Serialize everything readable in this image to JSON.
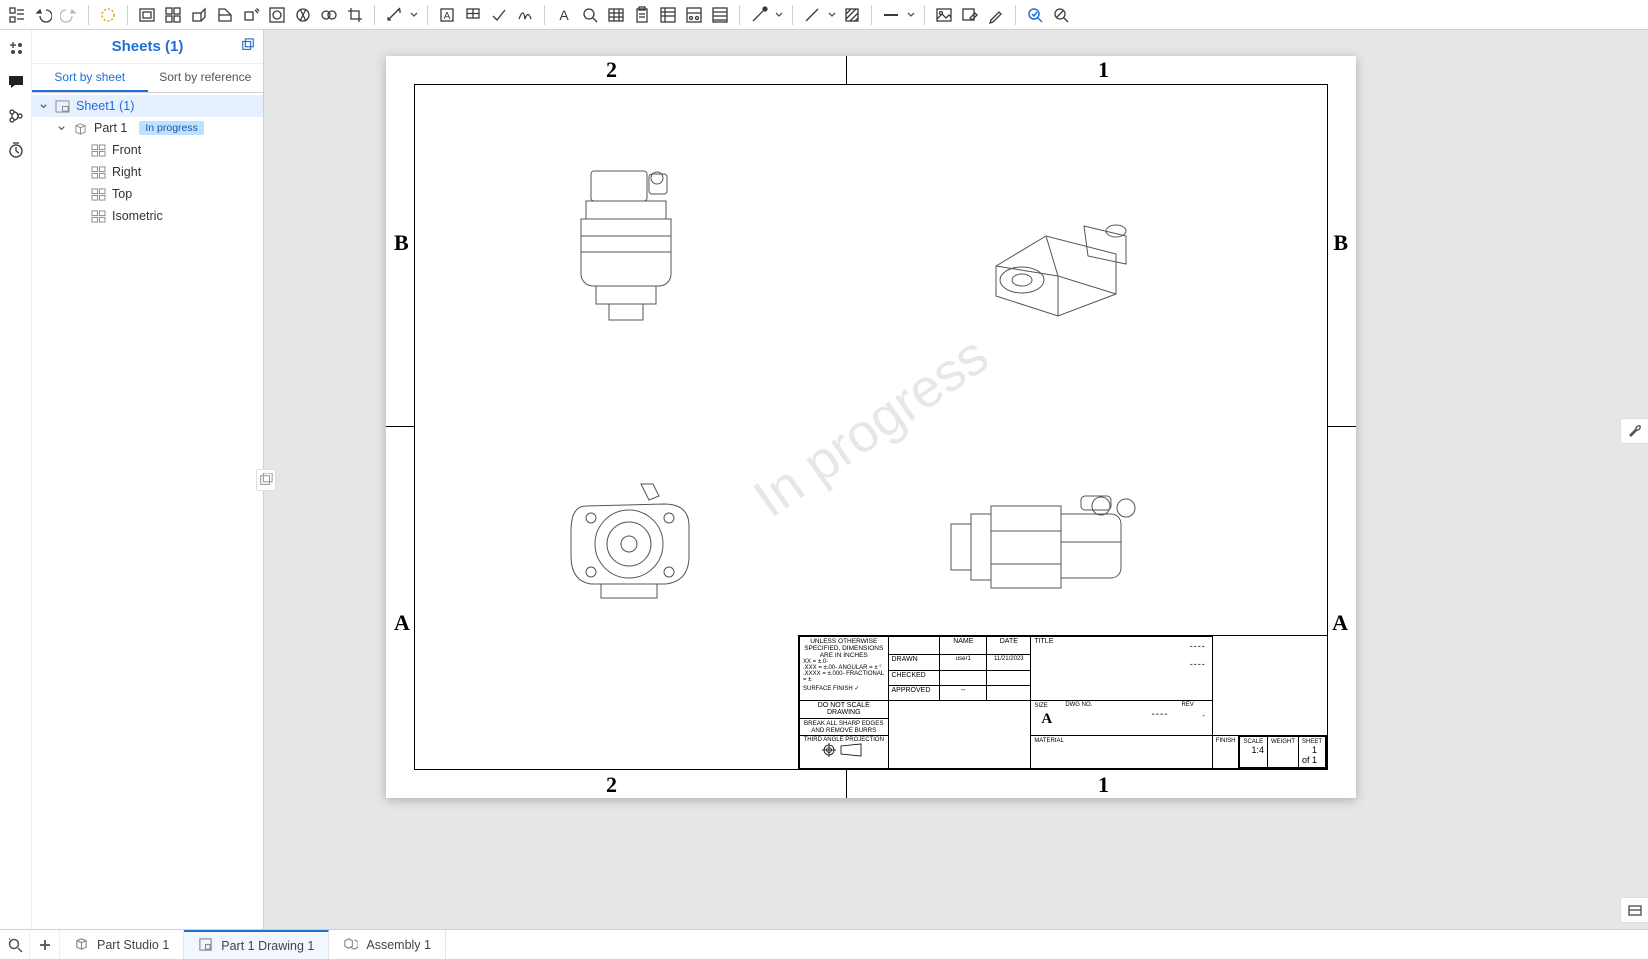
{
  "toolbar": {
    "icons": [
      "feature-tree-icon",
      "undo-icon",
      "redo-icon",
      "sep",
      "sketch-icon",
      "sep",
      "insert-view-icon",
      "four-view-icon",
      "projected-view-icon",
      "section-view-icon",
      "aux-view-icon",
      "detail-view-icon",
      "break-view-icon",
      "broken-out-icon",
      "crop-view-icon",
      "sep",
      "dimension-icon",
      "dd",
      "sep",
      "note-icon",
      "callout-icon",
      "check-icon",
      "surface-finish-icon",
      "sep",
      "text-icon",
      "search-zoom-icon",
      "table-icon",
      "paste-icon",
      "bom-icon",
      "hole-table-icon",
      "rev-table-icon",
      "sep",
      "line-color-icon",
      "dd",
      "sep",
      "line-icon",
      "dd",
      "hatch-icon",
      "sep",
      "line-style-icon",
      "dd",
      "sep",
      "image-icon",
      "image-edit-icon",
      "marker-icon",
      "sep",
      "inspection-on-icon",
      "inspection-off-icon"
    ]
  },
  "leftRail": {
    "items": [
      {
        "name": "add-feature-icon"
      },
      {
        "name": "comments-icon",
        "color": "#1f6fd6"
      },
      {
        "name": "versions-icon"
      },
      {
        "name": "history-timer-icon"
      }
    ]
  },
  "sheetsPanel": {
    "title": "Sheets (1)",
    "tabs": {
      "bySheet": "Sort by sheet",
      "byRef": "Sort by reference"
    },
    "activeTab": "bySheet",
    "tree": {
      "sheet": {
        "label": "Sheet1 (1)",
        "selected": true
      },
      "part": {
        "label": "Part 1",
        "badge": "In progress"
      },
      "views": [
        {
          "label": "Front",
          "name": "view-front"
        },
        {
          "label": "Right",
          "name": "view-right"
        },
        {
          "label": "Top",
          "name": "view-top"
        },
        {
          "label": "Isometric",
          "name": "view-isometric"
        }
      ]
    }
  },
  "sheet": {
    "watermark": "In progress",
    "zones": {
      "cols": [
        "2",
        "1"
      ],
      "rows": [
        "B",
        "A"
      ]
    },
    "titleblock": {
      "spec": "UNLESS OTHERWISE SPECIFIED, DIMENSIONS ARE IN INCHES",
      "tol1": "XX = ±.0-",
      "tol2": ".XXX = ±.00-    ANGULAR = ± °",
      "tol3": ".XXXX = ±.000-    FRACTIONAL = ±",
      "surf": "SURFACE FINISH",
      "noscale": "DO NOT SCALE DRAWING",
      "break": "BREAK ALL SHARP EDGES AND REMOVE BURRS",
      "proj": "THIRD ANGLE PROJECTION",
      "headers": {
        "name": "NAME",
        "date": "DATE",
        "drawn": "DRAWN",
        "checked": "CHECKED",
        "approved": "APPROVED",
        "material": "MATERIAL",
        "finish": "FINISH",
        "title": "TITLE",
        "size": "SIZE",
        "dwg": "DWG NO.",
        "rev": "REV",
        "scale": "SCALE",
        "weight": "WEIGHT",
        "sheet": "SHEET"
      },
      "values": {
        "drawnName": "user1",
        "drawnDate": "11/21/2023",
        "size": "A",
        "scale": "1:4",
        "sheet": "1 of 1",
        "titleDash": "----",
        "dwgDash": "----",
        "revDash": "-"
      }
    }
  },
  "bottomTabs": {
    "search": "search-tabs-icon",
    "add": "add-tab-icon",
    "tabs": [
      {
        "label": "Part Studio 1",
        "name": "tab-part-studio-1",
        "icon": "cube-icon",
        "active": false
      },
      {
        "label": "Part 1 Drawing 1",
        "name": "tab-part-1-drawing-1",
        "icon": "sheet-icon",
        "active": true
      },
      {
        "label": "Assembly 1",
        "name": "tab-assembly-1",
        "icon": "assembly-icon",
        "active": false
      }
    ]
  },
  "rightFly": {
    "wrench": "tools-flyout-icon",
    "panel": "panel-flyout-icon"
  }
}
